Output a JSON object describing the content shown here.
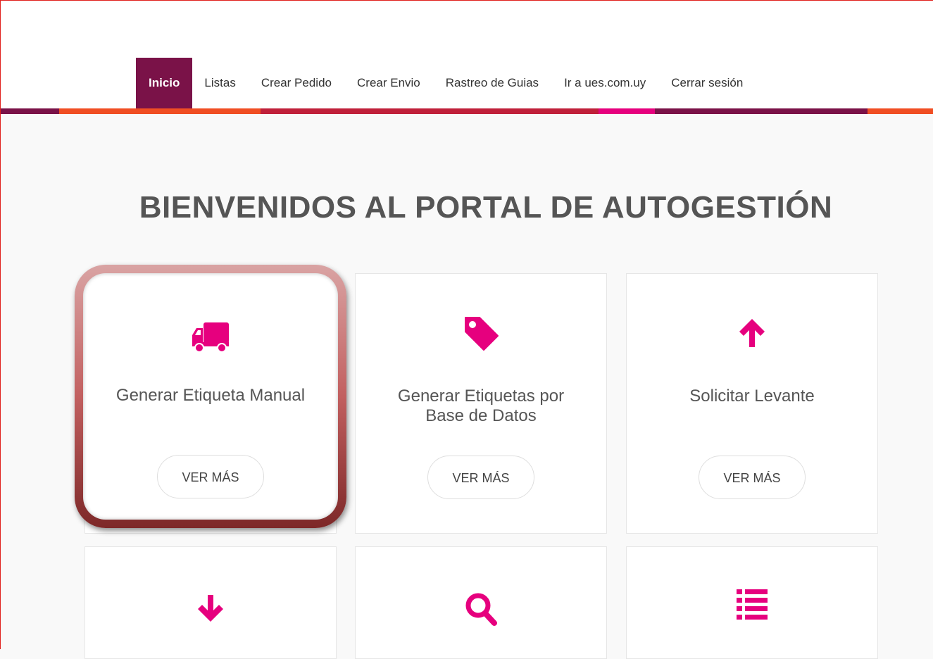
{
  "nav": {
    "items": [
      {
        "label": "Inicio",
        "active": true
      },
      {
        "label": "Listas"
      },
      {
        "label": "Crear Pedido"
      },
      {
        "label": "Crear Envio"
      },
      {
        "label": "Rastreo de Guias"
      },
      {
        "label": "Ir a ues.com.uy"
      },
      {
        "label": "Cerrar sesión"
      }
    ]
  },
  "colors": {
    "accent": "#e6007e",
    "brand_dark": "#7a1248",
    "orange": "#f04e23",
    "red": "#c0203a"
  },
  "main": {
    "title": "BIENVENIDOS AL PORTAL DE AUTOGESTIÓN",
    "cards": [
      {
        "icon": "truck-icon",
        "label": "Generar Etiqueta Manual",
        "button": "VER MÁS"
      },
      {
        "icon": "tag-icon",
        "label": "Generar Etiquetas por Base de Datos",
        "button": "VER MÁS"
      },
      {
        "icon": "arrow-up-icon",
        "label": "Solicitar Levante",
        "button": "VER MÁS"
      },
      {
        "icon": "arrow-down-icon"
      },
      {
        "icon": "search-icon"
      },
      {
        "icon": "list-icon"
      }
    ]
  }
}
